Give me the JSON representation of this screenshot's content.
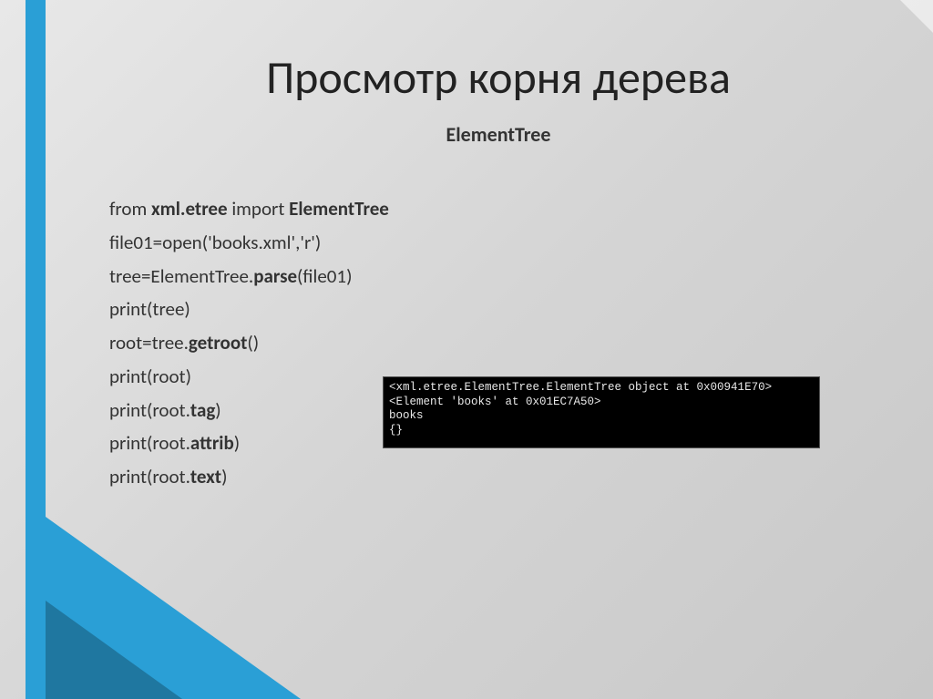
{
  "title": "Просмотр корня дерева",
  "subtitle": "ElementTree",
  "code": {
    "line1_pre": "from ",
    "line1_mod": "xml.etree",
    "line1_mid": " import ",
    "line1_cls": "ElementTree",
    "line2": "file01=open('books.xml','r')",
    "line3_pre": "tree=ElementTree.",
    "line3_b": "parse",
    "line3_post": "(file01)",
    "line4": "print(tree)",
    "line5_pre": "root=tree.",
    "line5_b": "getroot",
    "line5_post": "()",
    "line6": "print(root)",
    "line7_pre": "print(root.",
    "line7_b": "tag",
    "line7_post": ")",
    "line8_pre": "print(root.",
    "line8_b": "attrib",
    "line8_post": ")",
    "line9_pre": "print(root.",
    "line9_b": "text",
    "line9_post": ")"
  },
  "terminal": "<xml.etree.ElementTree.ElementTree object at 0x00941E70>\n<Element 'books' at 0x01EC7A50>\nbooks\n{}"
}
